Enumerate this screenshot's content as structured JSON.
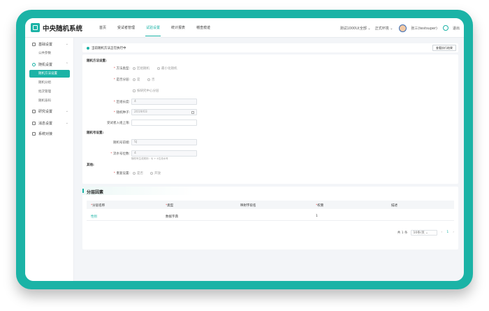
{
  "header": {
    "brand": "中央随机系统",
    "nav": [
      "首页",
      "受试者管理",
      "试验设置",
      "统计报表",
      "稽查痕迹"
    ],
    "active_nav": "试验设置",
    "project": "测试1000U(全部 ⌄",
    "env": "正式环境 ⌄",
    "user": "张三(testsuper)",
    "logout": "退出"
  },
  "sidebar": {
    "groups": [
      {
        "label": "基础设置",
        "icon": "grid-icon"
      },
      {
        "label": "随机设置",
        "icon": "dice-icon"
      },
      {
        "label": "研究设置",
        "icon": "chart-icon"
      },
      {
        "label": "消息设置",
        "icon": "bell-icon"
      },
      {
        "label": "系统对接",
        "icon": "link-icon"
      }
    ],
    "base_items": [
      "公共参数"
    ],
    "random_items": [
      "随机方法设置",
      "随机分组",
      "批次管理",
      "随机盲码"
    ],
    "active_item": "随机方法设置"
  },
  "status": {
    "text": "当前随机方法正在执行中",
    "button": "查看执行结果"
  },
  "form": {
    "method_section": "随机方法设置:",
    "method_label": "方法类型:",
    "method_options": [
      "区组随机",
      "最小化随机"
    ],
    "stratify_label": "是否分层:",
    "stratify_options": [
      "是",
      "否"
    ],
    "center_option": "按研究中心分层",
    "block_label": "区组长度:",
    "block_value": "4",
    "seed_label": "随机种子:",
    "seed_value": "2019/03",
    "max_label": "受试者入组上限:",
    "max_value": "",
    "number_section": "随机号设置:",
    "prefix_label": "随机号前缀:",
    "prefix_value": "SJ",
    "digits_label": "流水号位数:",
    "digits_value": "4",
    "digits_hint": "随机号生成规则：SJ + 4位流水号",
    "other_section": "其他:",
    "blind_label": "重复设置:",
    "blind_options": [
      "是否",
      "开放"
    ]
  },
  "table": {
    "title": "分层因素",
    "columns": [
      "分层名称",
      "类型",
      "映射字段名",
      "权重",
      "描述"
    ],
    "required": [
      true,
      true,
      false,
      true,
      false
    ],
    "rows": [
      {
        "name": "性别",
        "type": "数据字典",
        "field": "",
        "weight": "1",
        "desc": ""
      }
    ]
  },
  "pager": {
    "total": "共 1 条",
    "size": "10条/页 ⌄",
    "prev": "‹",
    "page": "1",
    "next": "›"
  }
}
